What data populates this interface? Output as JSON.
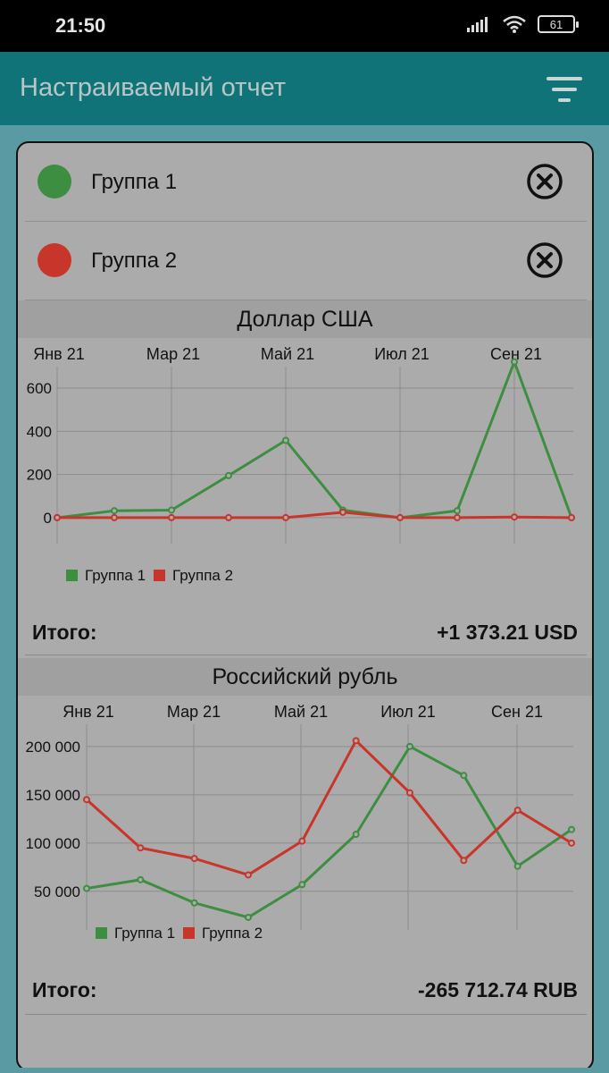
{
  "status_bar": {
    "time": "21:50",
    "battery": "61"
  },
  "app_bar": {
    "title": "Настраиваемый отчет",
    "filter_icon": "filter-icon"
  },
  "groups": [
    {
      "label": "Группа 1",
      "color": "#3e8e41"
    },
    {
      "label": "Группа 2",
      "color": "#c8352b"
    }
  ],
  "sections": [
    {
      "title": "Доллар США",
      "total_label": "Итого:",
      "total_value": "+1 373.21 USD"
    },
    {
      "title": "Российский рубль",
      "total_label": "Итого:",
      "total_value": "-265 712.74 RUB"
    }
  ],
  "chart_data": [
    {
      "type": "line",
      "x_tick_labels": [
        "Янв 21",
        "Мар 21",
        "Май 21",
        "Июл 21",
        "Сен 21"
      ],
      "y_tick_labels": [
        "0",
        "200",
        "400",
        "600"
      ],
      "ylim": [
        0,
        800
      ],
      "grid": true,
      "legend": "bottom-left",
      "series": [
        {
          "name": "Группа 1",
          "color": "#3e8e41",
          "values": [
            0,
            32,
            35,
            195,
            358,
            35,
            0,
            32,
            722,
            0
          ]
        },
        {
          "name": "Группа 2",
          "color": "#c8352b",
          "values": [
            0,
            0,
            0,
            0,
            0,
            25,
            0,
            0,
            3,
            0
          ]
        }
      ]
    },
    {
      "type": "line",
      "x_tick_labels": [
        "Янв 21",
        "Мар 21",
        "Май 21",
        "Июл 21",
        "Сен 21"
      ],
      "y_tick_labels": [
        "50 000",
        "100 000",
        "150 000",
        "200 000"
      ],
      "ylim": [
        10000,
        225000
      ],
      "grid": true,
      "legend": "bottom-left",
      "series": [
        {
          "name": "Группа 1",
          "color": "#3e8e41",
          "values": [
            53000,
            62000,
            38000,
            23000,
            57000,
            109000,
            200000,
            170000,
            76000,
            114000
          ]
        },
        {
          "name": "Группа 2",
          "color": "#c8352b",
          "values": [
            145000,
            95000,
            84000,
            67000,
            102000,
            206000,
            152000,
            82000,
            134000,
            100000
          ]
        }
      ]
    }
  ]
}
